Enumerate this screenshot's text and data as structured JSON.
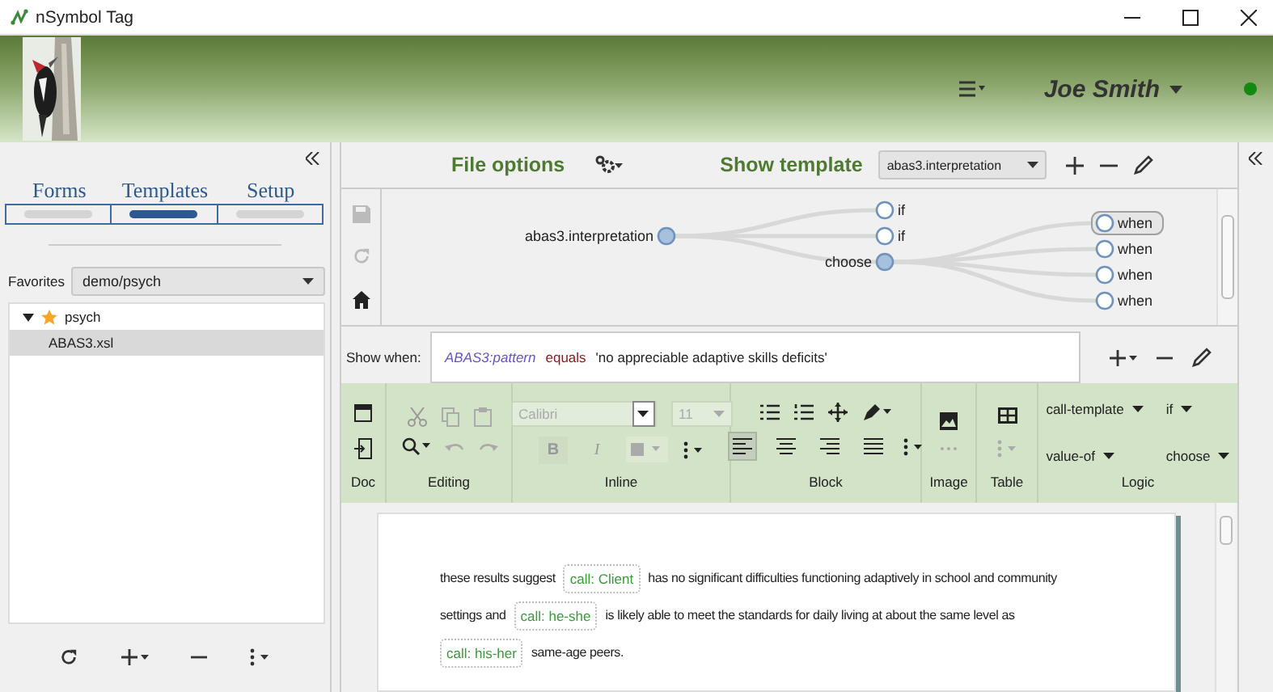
{
  "window": {
    "title": "nSymbol Tag"
  },
  "header": {
    "user": "Joe Smith"
  },
  "sidebar": {
    "tabs": [
      {
        "label": "Forms",
        "selected": false
      },
      {
        "label": "Templates",
        "selected": true
      },
      {
        "label": "Setup",
        "selected": false
      }
    ],
    "favorites": {
      "label": "Favorites",
      "value": "demo/psych"
    },
    "tree": [
      {
        "label": "psych",
        "starred": true,
        "expanded": true,
        "selected": false,
        "children": [
          {
            "label": "ABAS3.xsl",
            "starred": false,
            "selected": true
          }
        ]
      }
    ]
  },
  "toolbar": {
    "file_options": "File options",
    "show_template": "Show template",
    "template": "abas3.interpretation"
  },
  "diagram": {
    "label": "abas3.interpretation",
    "selected": false,
    "children": [
      {
        "label": "if",
        "selected": false
      },
      {
        "label": "if",
        "selected": false
      },
      {
        "label": "choose",
        "selected": false,
        "children": [
          {
            "label": "when",
            "selected": true
          },
          {
            "label": "when",
            "selected": false
          },
          {
            "label": "when",
            "selected": false
          },
          {
            "label": "when",
            "selected": false
          }
        ]
      }
    ]
  },
  "condition": {
    "label": "Show when:",
    "field": "ABAS3:pattern",
    "operator": "equals",
    "value": "'no appreciable adaptive skills deficits'"
  },
  "ribbon": {
    "font": "Calibri",
    "size": "11",
    "bold": "B",
    "italic": "I",
    "alignments": [
      {
        "kind": "left",
        "selected": true
      },
      {
        "kind": "center",
        "selected": false
      },
      {
        "kind": "right",
        "selected": false
      },
      {
        "kind": "justify",
        "selected": false
      }
    ],
    "logic": [
      "call-template",
      "if",
      "value-of",
      "choose"
    ],
    "groups": [
      "Doc",
      "Editing",
      "Inline",
      "Block",
      "Image",
      "Table",
      "Logic"
    ]
  },
  "document": {
    "lines": [
      {
        "segments": [
          {
            "kind": "text",
            "text": "these results suggest"
          },
          {
            "kind": "call",
            "text": "call: Client"
          },
          {
            "kind": "text",
            "text": "has no significant difficulties functioning adaptively in school and community"
          }
        ]
      },
      {
        "segments": [
          {
            "kind": "text",
            "text": "settings and"
          },
          {
            "kind": "call",
            "text": "call: he-she"
          },
          {
            "kind": "text",
            "text": "is likely able to meet the standards for daily living at about the same level as"
          }
        ]
      },
      {
        "segments": [
          {
            "kind": "call",
            "text": "call: his-her"
          },
          {
            "kind": "text",
            "text": "same-age peers."
          }
        ]
      }
    ]
  }
}
